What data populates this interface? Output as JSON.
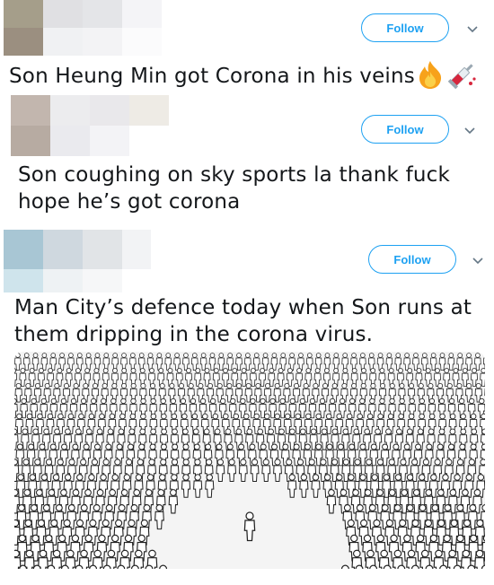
{
  "tweets": [
    {
      "text": "Son Heung Min got Corona in his veins",
      "follow_label": "Follow",
      "emoji": [
        "fire-emoji",
        "syringe-emoji"
      ]
    },
    {
      "text_line1": "Son coughing on sky sports la thank fuck",
      "text_line2": "hope he’s got corona",
      "follow_label": "Follow"
    },
    {
      "text_line1": "Man City’s defence today when Son runs at",
      "text_line2": "them dripping in the corona virus.",
      "follow_label": "Follow",
      "image": "crowd-illustration"
    }
  ],
  "colors": {
    "accent": "#1da1f2",
    "text": "#14171a",
    "chevron": "#657786"
  }
}
